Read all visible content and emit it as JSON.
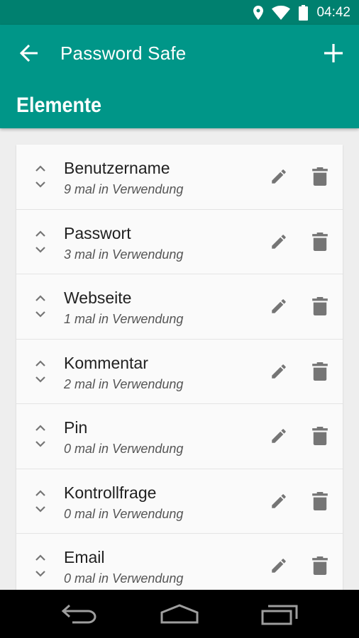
{
  "status_bar": {
    "time": "04:42",
    "icons": [
      "location-icon",
      "wifi-icon",
      "battery-icon"
    ]
  },
  "app_bar": {
    "title": "Password Safe",
    "section_title": "Elemente",
    "back_icon": "arrow-back-icon",
    "add_icon": "plus-icon"
  },
  "items": [
    {
      "title": "Benutzername",
      "subtitle": "9 mal in Verwendung"
    },
    {
      "title": "Passwort",
      "subtitle": "3 mal in Verwendung"
    },
    {
      "title": "Webseite",
      "subtitle": "1 mal in Verwendung"
    },
    {
      "title": "Kommentar",
      "subtitle": "2 mal in Verwendung"
    },
    {
      "title": "Pin",
      "subtitle": "0 mal in Verwendung"
    },
    {
      "title": "Kontrollfrage",
      "subtitle": "0 mal in Verwendung"
    },
    {
      "title": "Email",
      "subtitle": "0 mal in Verwendung"
    }
  ],
  "colors": {
    "primary": "#009688",
    "primary_dark": "#00806f",
    "icon_gray": "#757575"
  }
}
